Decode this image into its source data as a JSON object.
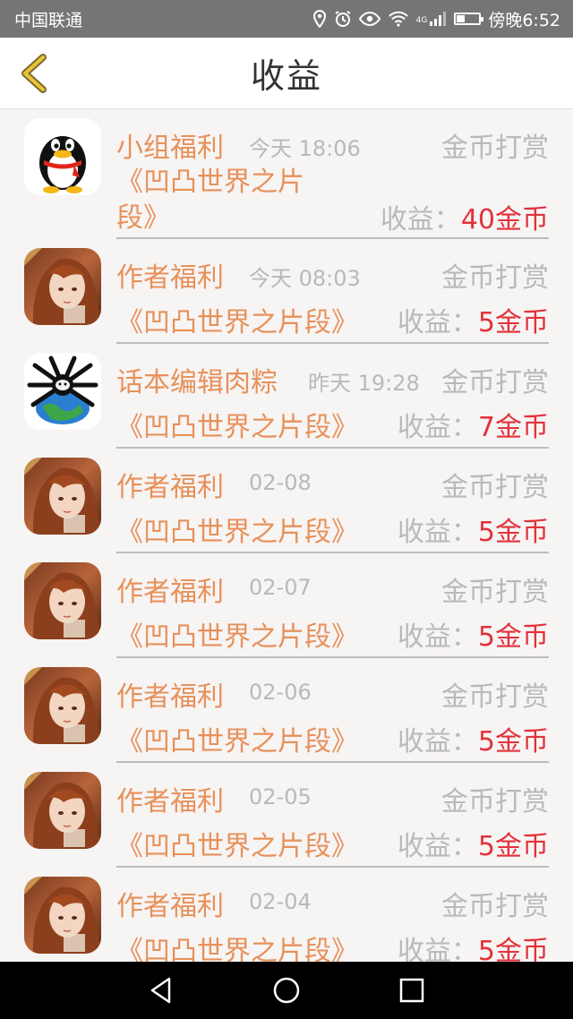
{
  "status_bar": {
    "carrier": "中国联通",
    "network": "4G",
    "time": "傍晚6:52",
    "icons": [
      "location-icon",
      "alarm-icon",
      "eye-icon",
      "wifi-icon",
      "signal-icon",
      "battery-icon"
    ],
    "battery_level": 0.35
  },
  "header": {
    "title": "收益",
    "back_icon": "chevron-left-icon"
  },
  "colors": {
    "accent": "#e7915a",
    "amount": "#e2323b",
    "muted": "#b9b9b9",
    "back": "#e8c33a"
  },
  "records": [
    {
      "avatar": "qq-penguin",
      "role": "小组福利",
      "time": "今天 18:06",
      "reward": "金币打赏",
      "work": "《凹凸世界之片段》",
      "income_label": "收益：",
      "amount": "40金币"
    },
    {
      "avatar": "anime-girl",
      "role": "作者福利",
      "time": "今天 08:03",
      "reward": "金币打赏",
      "work": "《凹凸世界之片段》",
      "income_label": "收益：",
      "amount": "5金币"
    },
    {
      "avatar": "spider-globe",
      "role": "话本编辑肉粽",
      "time": "昨天 19:28",
      "reward": "金币打赏",
      "work": "《凹凸世界之片段》",
      "income_label": "收益：",
      "amount": "7金币"
    },
    {
      "avatar": "anime-girl",
      "role": "作者福利",
      "time": "02-08",
      "reward": "金币打赏",
      "work": "《凹凸世界之片段》",
      "income_label": "收益：",
      "amount": "5金币"
    },
    {
      "avatar": "anime-girl",
      "role": "作者福利",
      "time": "02-07",
      "reward": "金币打赏",
      "work": "《凹凸世界之片段》",
      "income_label": "收益：",
      "amount": "5金币"
    },
    {
      "avatar": "anime-girl",
      "role": "作者福利",
      "time": "02-06",
      "reward": "金币打赏",
      "work": "《凹凸世界之片段》",
      "income_label": "收益：",
      "amount": "5金币"
    },
    {
      "avatar": "anime-girl",
      "role": "作者福利",
      "time": "02-05",
      "reward": "金币打赏",
      "work": "《凹凸世界之片段》",
      "income_label": "收益：",
      "amount": "5金币"
    },
    {
      "avatar": "anime-girl",
      "role": "作者福利",
      "time": "02-04",
      "reward": "金币打赏",
      "work": "《凹凸世界之片段》",
      "income_label": "收益：",
      "amount": "5金币"
    }
  ],
  "nav_bar": {
    "buttons": [
      "back-triangle-icon",
      "home-circle-icon",
      "recents-square-icon"
    ]
  }
}
